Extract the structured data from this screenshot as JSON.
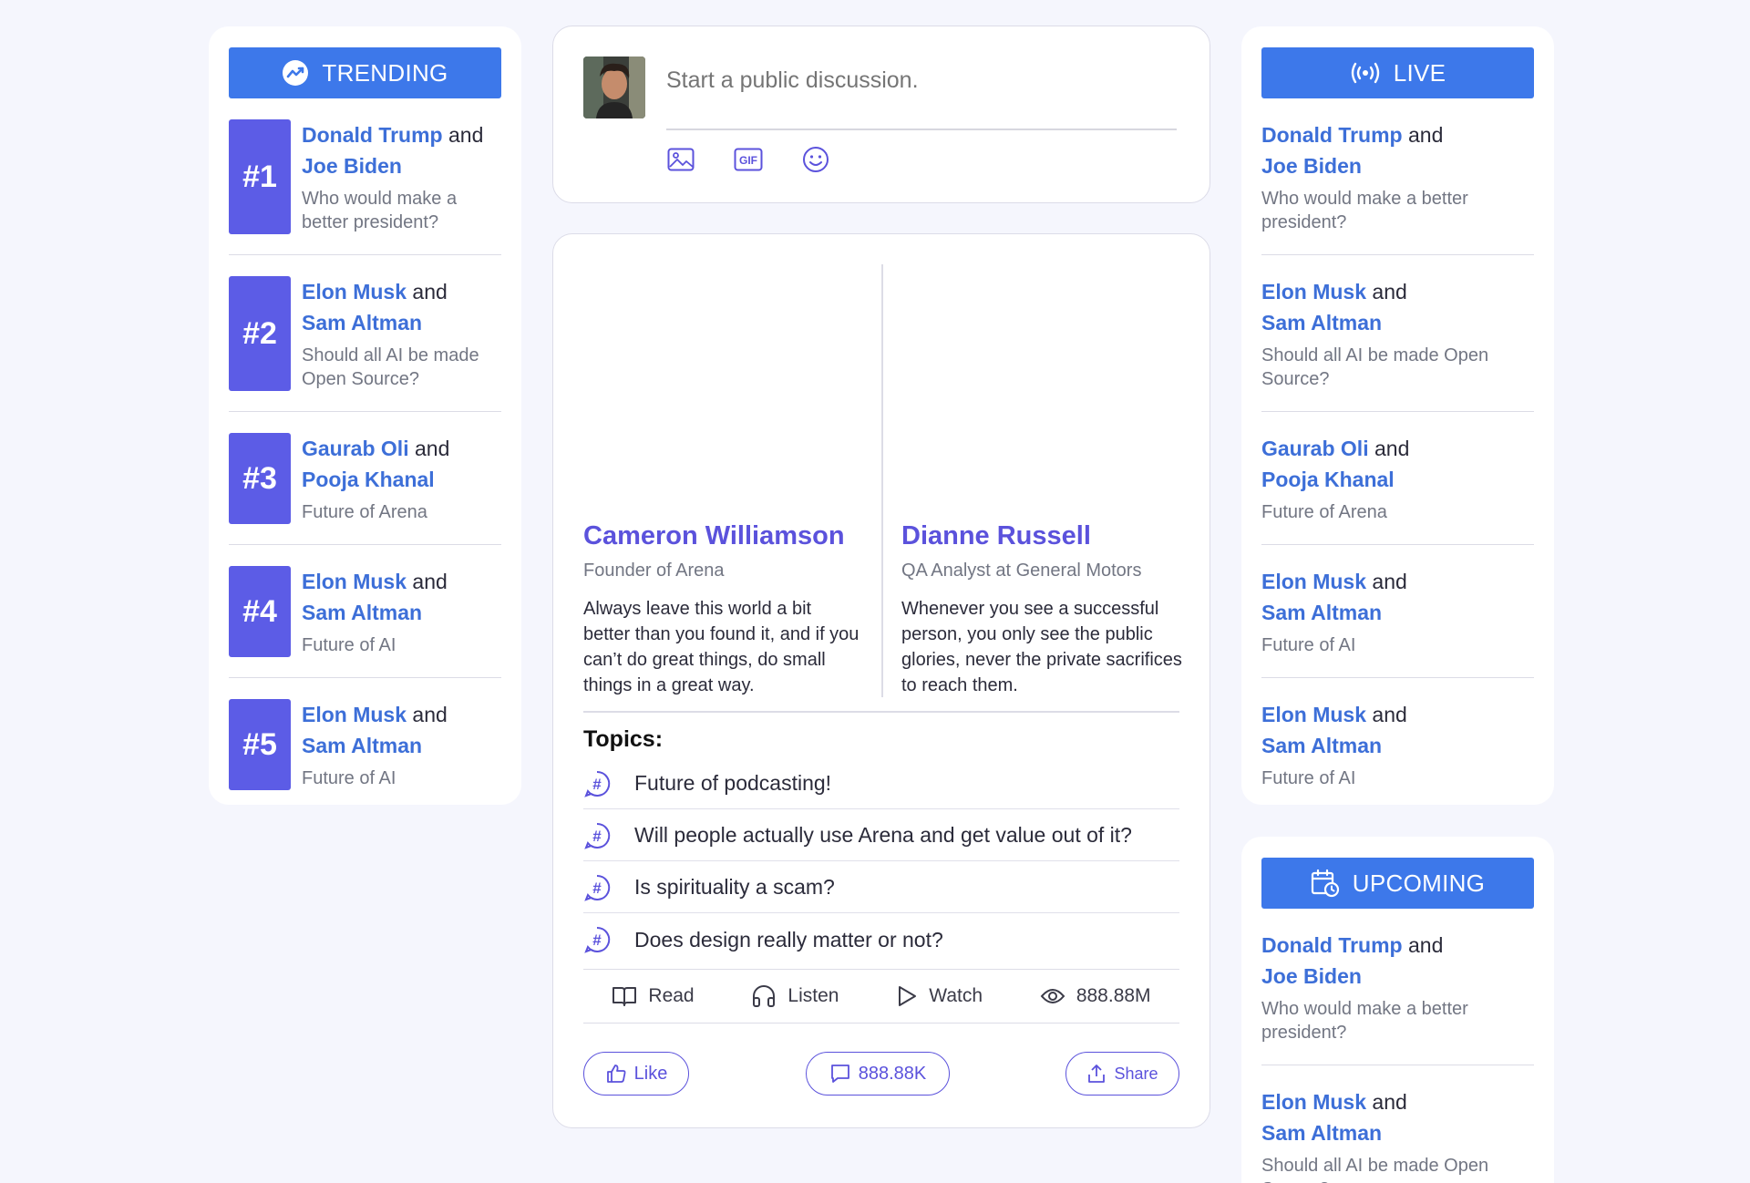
{
  "trending": {
    "header": "TRENDING",
    "icon": "trending-up-icon",
    "items": [
      {
        "rank": "#1",
        "name_a": "Donald Trump",
        "joiner": "and",
        "name_b": "Joe Biden",
        "question": "Who would make a better president?"
      },
      {
        "rank": "#2",
        "name_a": "Elon Musk",
        "joiner": "and",
        "name_b": "Sam Altman",
        "question": "Should all AI be made Open Source?"
      },
      {
        "rank": "#3",
        "name_a": "Gaurab Oli",
        "joiner": "and",
        "name_b": "Pooja Khanal",
        "question": "Future of Arena"
      },
      {
        "rank": "#4",
        "name_a": "Elon Musk",
        "joiner": "and",
        "name_b": "Sam Altman",
        "question": "Future of AI"
      },
      {
        "rank": "#5",
        "name_a": "Elon Musk",
        "joiner": "and",
        "name_b": "Sam Altman",
        "question": "Future of AI"
      }
    ]
  },
  "composer": {
    "placeholder": "Start a public discussion.",
    "tools": [
      "image-icon",
      "gif-icon",
      "emoji-icon"
    ]
  },
  "debate": {
    "left": {
      "name": "Cameron Williamson",
      "title": "Founder of Arena",
      "quote": "Always leave this world a bit better than you found it, and if you can’t do great things, do small things in a great way."
    },
    "right": {
      "name": "Dianne Russell",
      "title": "QA Analyst at General Motors",
      "quote": "Whenever you see a successful person, you only see the public glories, never the private sacrifices to reach them."
    },
    "topics_title": "Topics:",
    "topics": [
      "Future of podcasting!",
      "Will people actually use Arena and get value out of it?",
      "Is spirituality a scam?",
      "Does design really matter or not?"
    ],
    "stats": {
      "read": "Read",
      "listen": "Listen",
      "watch": "Watch",
      "views": "888.88M"
    },
    "actions": {
      "like": "Like",
      "comments": "888.88K",
      "share": "Share"
    }
  },
  "live": {
    "header": "LIVE",
    "icon": "broadcast-icon",
    "items": [
      {
        "name_a": "Donald Trump",
        "joiner": "and",
        "name_b": "Joe Biden",
        "question": "Who would make a better president?"
      },
      {
        "name_a": "Elon Musk",
        "joiner": "and",
        "name_b": "Sam Altman",
        "question": "Should all AI be made Open Source?"
      },
      {
        "name_a": "Gaurab Oli",
        "joiner": "and",
        "name_b": "Pooja Khanal",
        "question": "Future of Arena"
      },
      {
        "name_a": "Elon Musk",
        "joiner": "and",
        "name_b": "Sam Altman",
        "question": "Future of AI"
      },
      {
        "name_a": "Elon Musk",
        "joiner": "and",
        "name_b": "Sam Altman",
        "question": "Future of AI"
      }
    ]
  },
  "upcoming": {
    "header": "UPCOMING",
    "icon": "calendar-clock-icon",
    "items": [
      {
        "name_a": "Donald Trump",
        "joiner": "and",
        "name_b": "Joe Biden",
        "question": "Who would make a better president?"
      },
      {
        "name_a": "Elon Musk",
        "joiner": "and",
        "name_b": "Sam Altman",
        "question": "Should all AI be made Open Source?"
      }
    ]
  },
  "colors": {
    "accent_blue": "#3d78ea",
    "rank_purple": "#5c5ce6",
    "name_purple": "#5b52dc",
    "link_blue": "#3d6fd8",
    "background": "#f5f6fd"
  }
}
